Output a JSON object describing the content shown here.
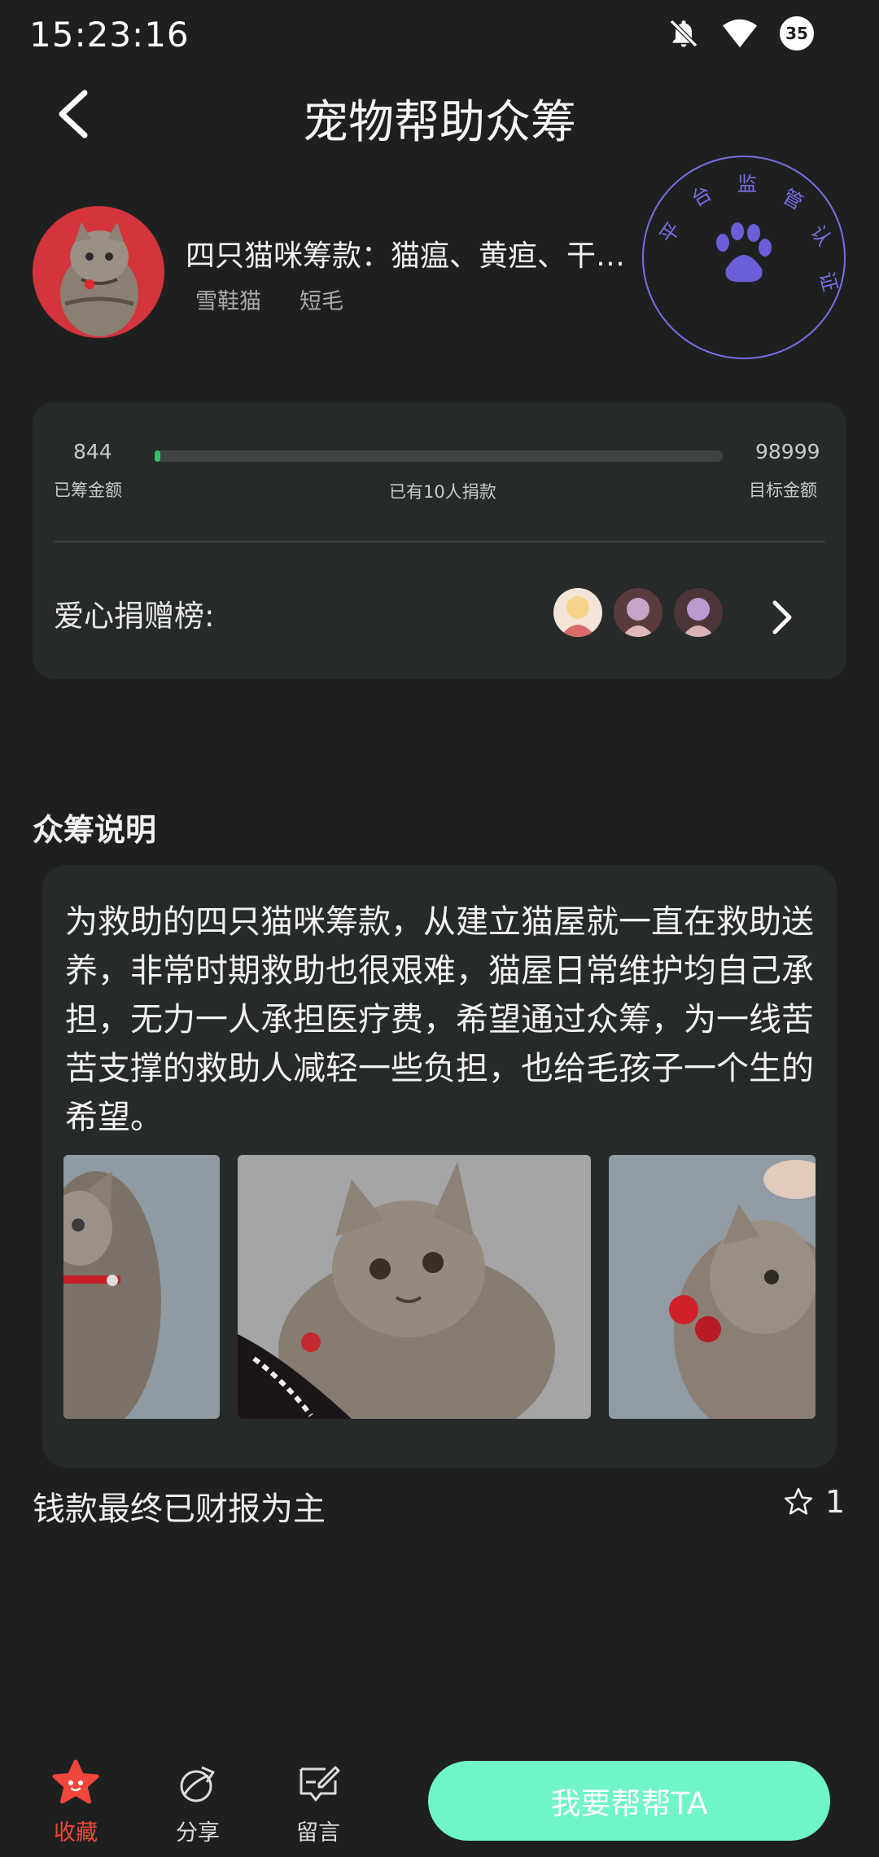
{
  "status_bar": {
    "time": "15:23:16",
    "battery": "35"
  },
  "header": {
    "title": "宠物帮助众筹"
  },
  "pet": {
    "title": "四只猫咪筹款：猫瘟、黄疸、干…",
    "tags": [
      "雪鞋猫",
      "短毛"
    ]
  },
  "seal": {
    "chars": [
      "平",
      "台",
      "监",
      "管",
      "认",
      "证"
    ],
    "color": "#7b6ee6"
  },
  "funding": {
    "raised": "844",
    "raised_label": "已筹金额",
    "target": "98999",
    "target_label": "目标金额",
    "donors_text": "已有10人捐款",
    "progress_fraction": 0.0085,
    "bar_color": "#36c068"
  },
  "donor_board": {
    "label": "爱心捐赠榜:"
  },
  "description": {
    "heading": "众筹说明",
    "text": "为救助的四只猫咪筹款，从建立猫屋就一直在救助送养，非常时期救助也很艰难，猫屋日常维护均自己承担，无力一人承担医疗费，希望通过众筹，为一线苦苦支撑的救助人减轻一些负担，也给毛孩子一个生的希望。"
  },
  "footer_note": {
    "text": "钱款最终已财报为主",
    "star_count": "1"
  },
  "bottom_bar": {
    "favorite_label": "收藏",
    "share_label": "分享",
    "comment_label": "留言",
    "help_button": "我要帮帮TA",
    "accent": "#f0463c",
    "cta_color": "#6ff5c7"
  }
}
